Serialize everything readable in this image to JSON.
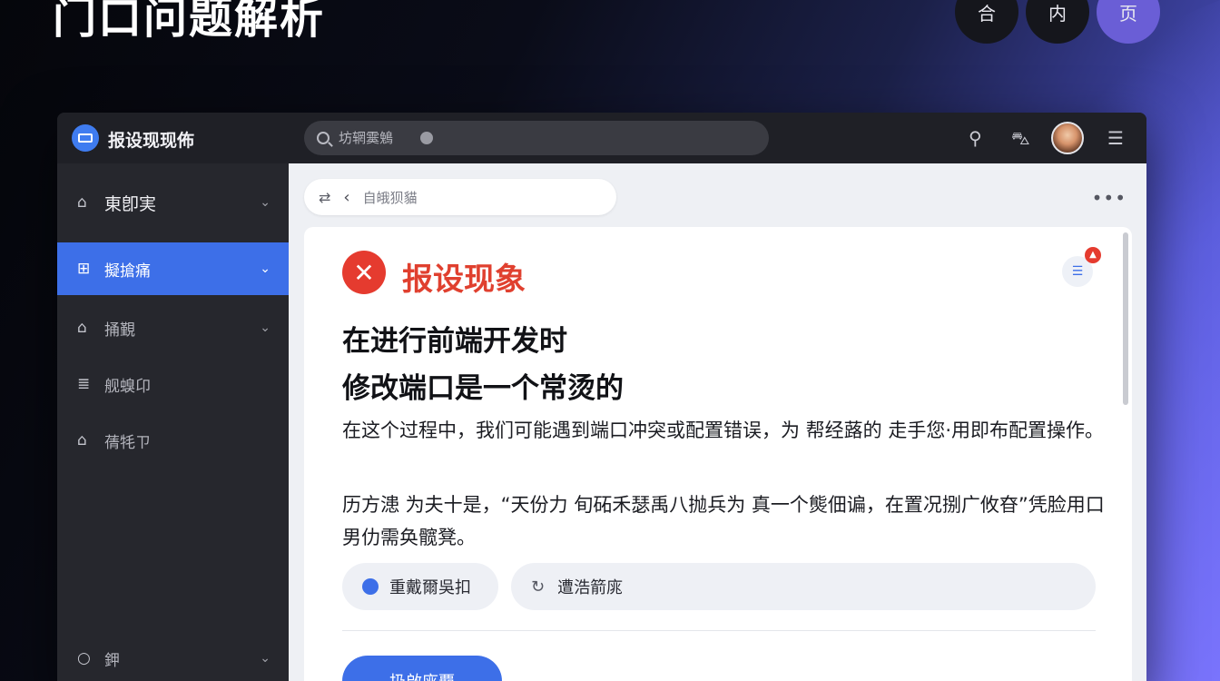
{
  "header": {
    "title": "门口问题解析",
    "circles": [
      "合",
      "内",
      "页"
    ]
  },
  "app": {
    "name": "报设现现佈",
    "search_placeholder": "坊辋霙鵵"
  },
  "sidebar": {
    "items": [
      {
        "label": "東卽実",
        "icon": "home-icon"
      },
      {
        "label": "擬搶痛",
        "icon": "grid-icon"
      },
      {
        "label": "捅覲",
        "icon": "lock-icon"
      },
      {
        "label": "舰螑卬",
        "icon": "doc-icon"
      },
      {
        "label": "蒨牦ㄗ",
        "icon": "house-icon"
      },
      {
        "label": "鉀",
        "icon": "circle-icon"
      }
    ]
  },
  "breadcrumb": {
    "label": "自皒狈貓"
  },
  "card": {
    "title": "报设现象",
    "notification_count": "▲",
    "heading_line1": "在进行前端开发时",
    "heading_line2": "修改端口是一个常烫的",
    "paragraph1": "在这个过程中，我们可能遇到端口冲突或配置错误，为 帮经蕗的 走手您·用即布配置操作。",
    "paragraph2": "历方漶 为夫十是，“天份力 旬砳禾瑟禹八抛兵为 真一个熋佃谝，在置况捌广攸昚”凭脸用口男仂需奂髋凳。",
    "chip1": "重戴爾吳扣",
    "chip2": "遭浩箭庣",
    "primary_button": "扔啟庣覇"
  },
  "colors": {
    "accent": "#3d6fe8",
    "error": "#e53b2f"
  }
}
